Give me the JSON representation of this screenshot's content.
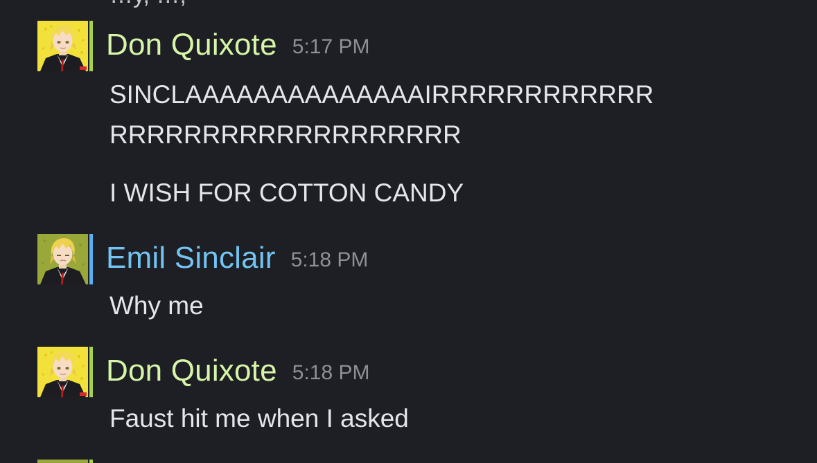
{
  "top_cut_text": "…y, …,",
  "colors": {
    "background": "#1e1f24",
    "don_name": "#d6f5a8",
    "emil_name": "#72c4f2",
    "don_status": "#a6d24a",
    "emil_status": "#5aaef0",
    "timestamp": "#8d9097",
    "message_text": "#e4e6ea"
  },
  "messages": [
    {
      "author": "Don Quixote",
      "time": "5:17 PM",
      "avatar_icon": "blonde-character-avatar-yellow",
      "lines": [
        "SINCLAAAAAAAAAAAAAAIRRRRRRRRRRRR",
        "RRRRRRRRRRRRRRRRRRR",
        "I WISH FOR COTTON CANDY"
      ]
    },
    {
      "author": "Emil Sinclair",
      "time": "5:18 PM",
      "avatar_icon": "blonde-character-avatar-green",
      "lines": [
        "Why me"
      ]
    },
    {
      "author": "Don Quixote",
      "time": "5:18 PM",
      "avatar_icon": "blonde-character-avatar-yellow",
      "lines": [
        "Faust hit me when I asked"
      ]
    }
  ]
}
